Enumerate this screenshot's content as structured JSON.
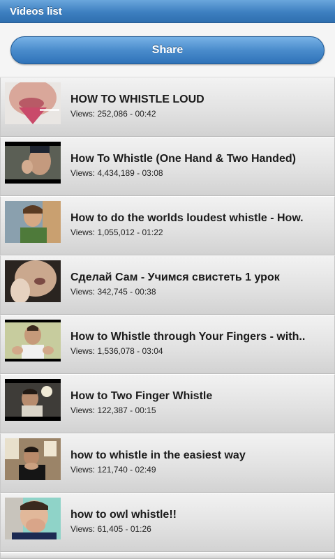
{
  "header": {
    "title": "Videos list"
  },
  "share": {
    "label": "Share"
  },
  "colors": {
    "accent": "#3d7fc0",
    "button": "#4a8ccc"
  },
  "videos": [
    {
      "title": "HOW TO WHISTLE LOUD",
      "meta": "Views: 252,086 - 00:42"
    },
    {
      "title": "How To Whistle (One Hand & Two Handed)",
      "meta": "Views: 4,434,189 - 03:08"
    },
    {
      "title": "How to do the worlds loudest whistle - How.",
      "meta": "Views: 1,055,012 - 01:22"
    },
    {
      "title": "Сделай Сам - Учимся свистеть 1 урок",
      "meta": "Views: 342,745 - 00:38"
    },
    {
      "title": "How to Whistle through Your Fingers - with..",
      "meta": "Views: 1,536,078 - 03:04"
    },
    {
      "title": "How to Two Finger Whistle",
      "meta": "Views: 122,387 - 00:15"
    },
    {
      "title": "how to whistle in the easiest way",
      "meta": "Views: 121,740 - 02:49"
    },
    {
      "title": "how to owl whistle!!",
      "meta": "Views: 61,405 - 01:26"
    }
  ]
}
